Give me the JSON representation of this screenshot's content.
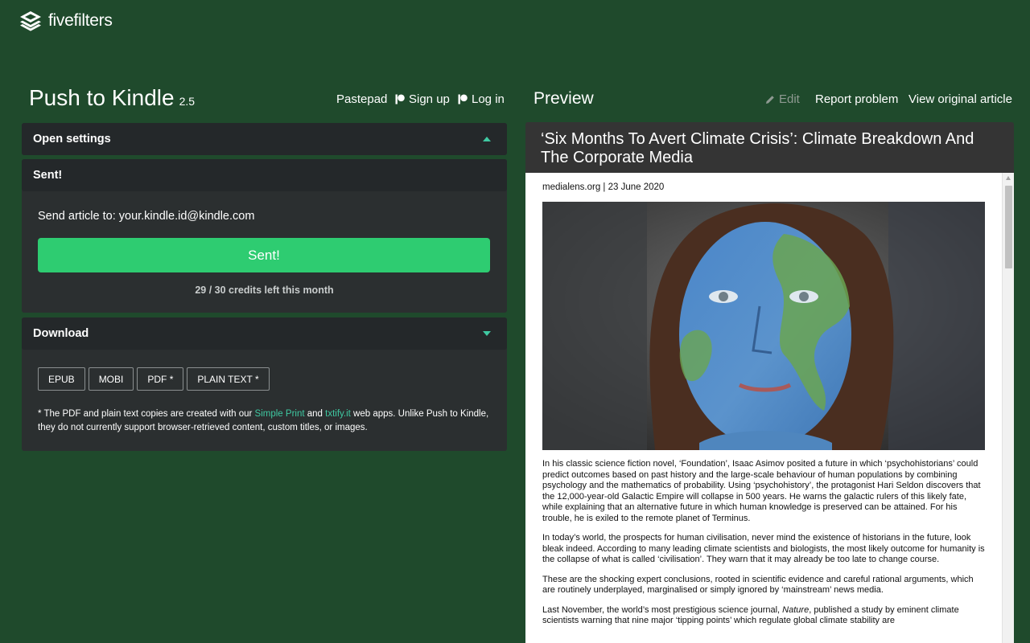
{
  "brand": {
    "name": "fivefilters"
  },
  "app": {
    "title": "Push to Kindle",
    "version": "2.5"
  },
  "nav": {
    "pastepad": "Pastepad",
    "signup": "Sign up",
    "login": "Log in"
  },
  "preview_header": {
    "title": "Preview",
    "edit": "Edit",
    "report": "Report problem",
    "view_original": "View original article"
  },
  "settings_panel": {
    "label": "Open settings"
  },
  "sent_panel": {
    "label": "Sent!",
    "send_to_label": "Send article to: your.kindle.id@kindle.com",
    "button_label": "Sent!",
    "credits": "29 / 30 credits left this month"
  },
  "download_panel": {
    "label": "Download",
    "buttons": [
      "EPUB",
      "MOBI",
      "PDF *",
      "PLAIN TEXT *"
    ],
    "note_prefix": "* The PDF and plain text copies are created with our ",
    "link1": "Simple Print",
    "note_and": " and ",
    "link2": "txtify.it",
    "note_suffix": " web apps. Unlike Push to Kindle, they do not currently support browser-retrieved content, custom titles, or images."
  },
  "article": {
    "title": "‘Six Months To Avert Climate Crisis’: Climate Breakdown And The Corporate Media",
    "byline": "medialens.org | 23 June 2020",
    "paragraphs": [
      "In his classic science fiction novel, ‘Foundation’, Isaac Asimov posited a future in which ‘psychohistorians’ could predict outcomes based on past history and the large-scale behaviour of human populations by combining psychology and the mathematics of probability. Using ‘psychohistory’, the protagonist Hari Seldon discovers that the 12,000-year-old Galactic Empire will collapse in 500 years. He warns the galactic rulers of this likely fate, while explaining that an alternative future in which human knowledge is preserved can be attained. For his trouble, he is exiled to the remote planet of Terminus.",
      "In today’s world, the prospects for human civilisation, never mind the existence of historians in the future, look bleak indeed. According to many leading climate scientists and biologists, the most likely outcome for humanity is the collapse of what is called ‘civilisation’. They warn that it may already be too late to change course.",
      "These are the shocking expert conclusions, rooted in scientific evidence and careful rational arguments, which are routinely underplayed, marginalised or simply ignored by ‘mainstream’ news media."
    ],
    "p4_prefix": "Last November, the world’s most prestigious science journal, ",
    "p4_italic": "Nature",
    "p4_suffix": ", published a study by eminent climate scientists warning that nine major ‘tipping points’ which regulate global climate stability are"
  },
  "colors": {
    "background": "#1f4a2c",
    "panel": "#2b2f30",
    "panel_header": "#24282a",
    "accent": "#3fc9a2",
    "send_button": "#2ecc71"
  },
  "icons": {
    "logo": "stacked-layers-icon",
    "patreon": "patreon-icon",
    "edit": "pencil-icon",
    "collapse": "caret-up-icon",
    "expand": "caret-down-icon"
  }
}
